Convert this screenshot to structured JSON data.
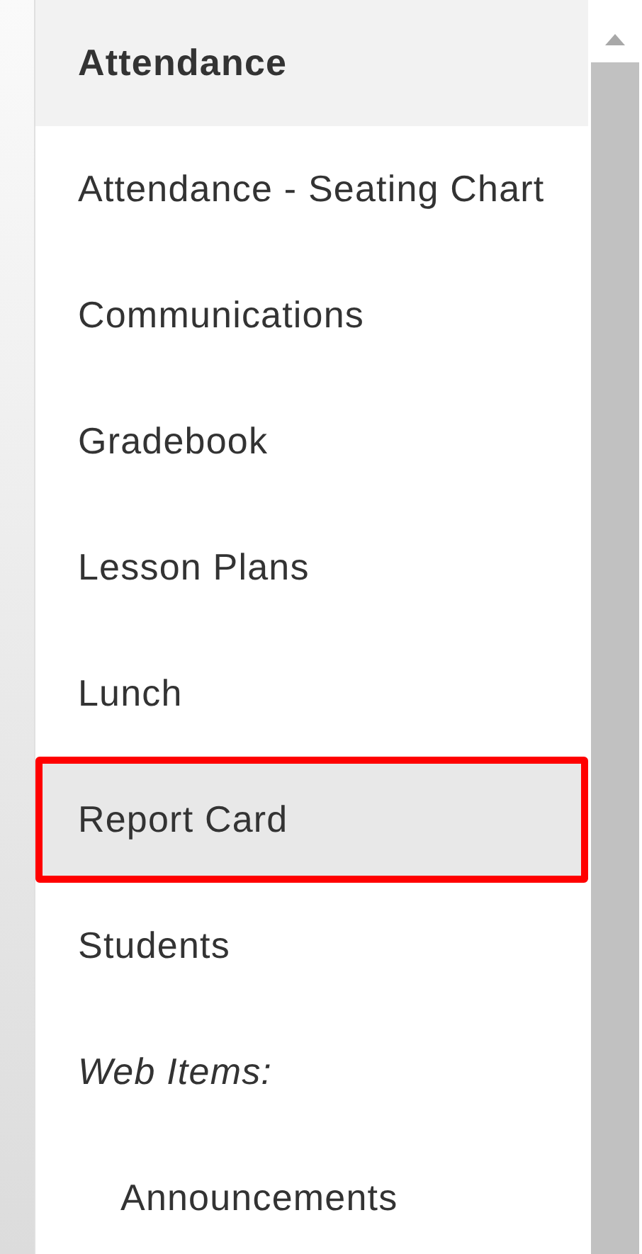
{
  "menu": {
    "items": [
      {
        "label": "Attendance",
        "kind": "heading",
        "selected": false,
        "annotated": false
      },
      {
        "label": "Attendance - Seating Chart",
        "kind": "item",
        "selected": false,
        "annotated": false
      },
      {
        "label": "Communications",
        "kind": "item",
        "selected": false,
        "annotated": false
      },
      {
        "label": "Gradebook",
        "kind": "item",
        "selected": false,
        "annotated": false
      },
      {
        "label": "Lesson Plans",
        "kind": "item",
        "selected": false,
        "annotated": false
      },
      {
        "label": "Lunch",
        "kind": "item",
        "selected": false,
        "annotated": false
      },
      {
        "label": "Report Card",
        "kind": "item",
        "selected": true,
        "annotated": true
      },
      {
        "label": "Students",
        "kind": "item",
        "selected": false,
        "annotated": false
      },
      {
        "label": "Web Items:",
        "kind": "group",
        "selected": false,
        "annotated": false,
        "children": [
          {
            "label": "Announcements",
            "kind": "item",
            "selected": false,
            "annotated": false
          }
        ]
      }
    ]
  }
}
